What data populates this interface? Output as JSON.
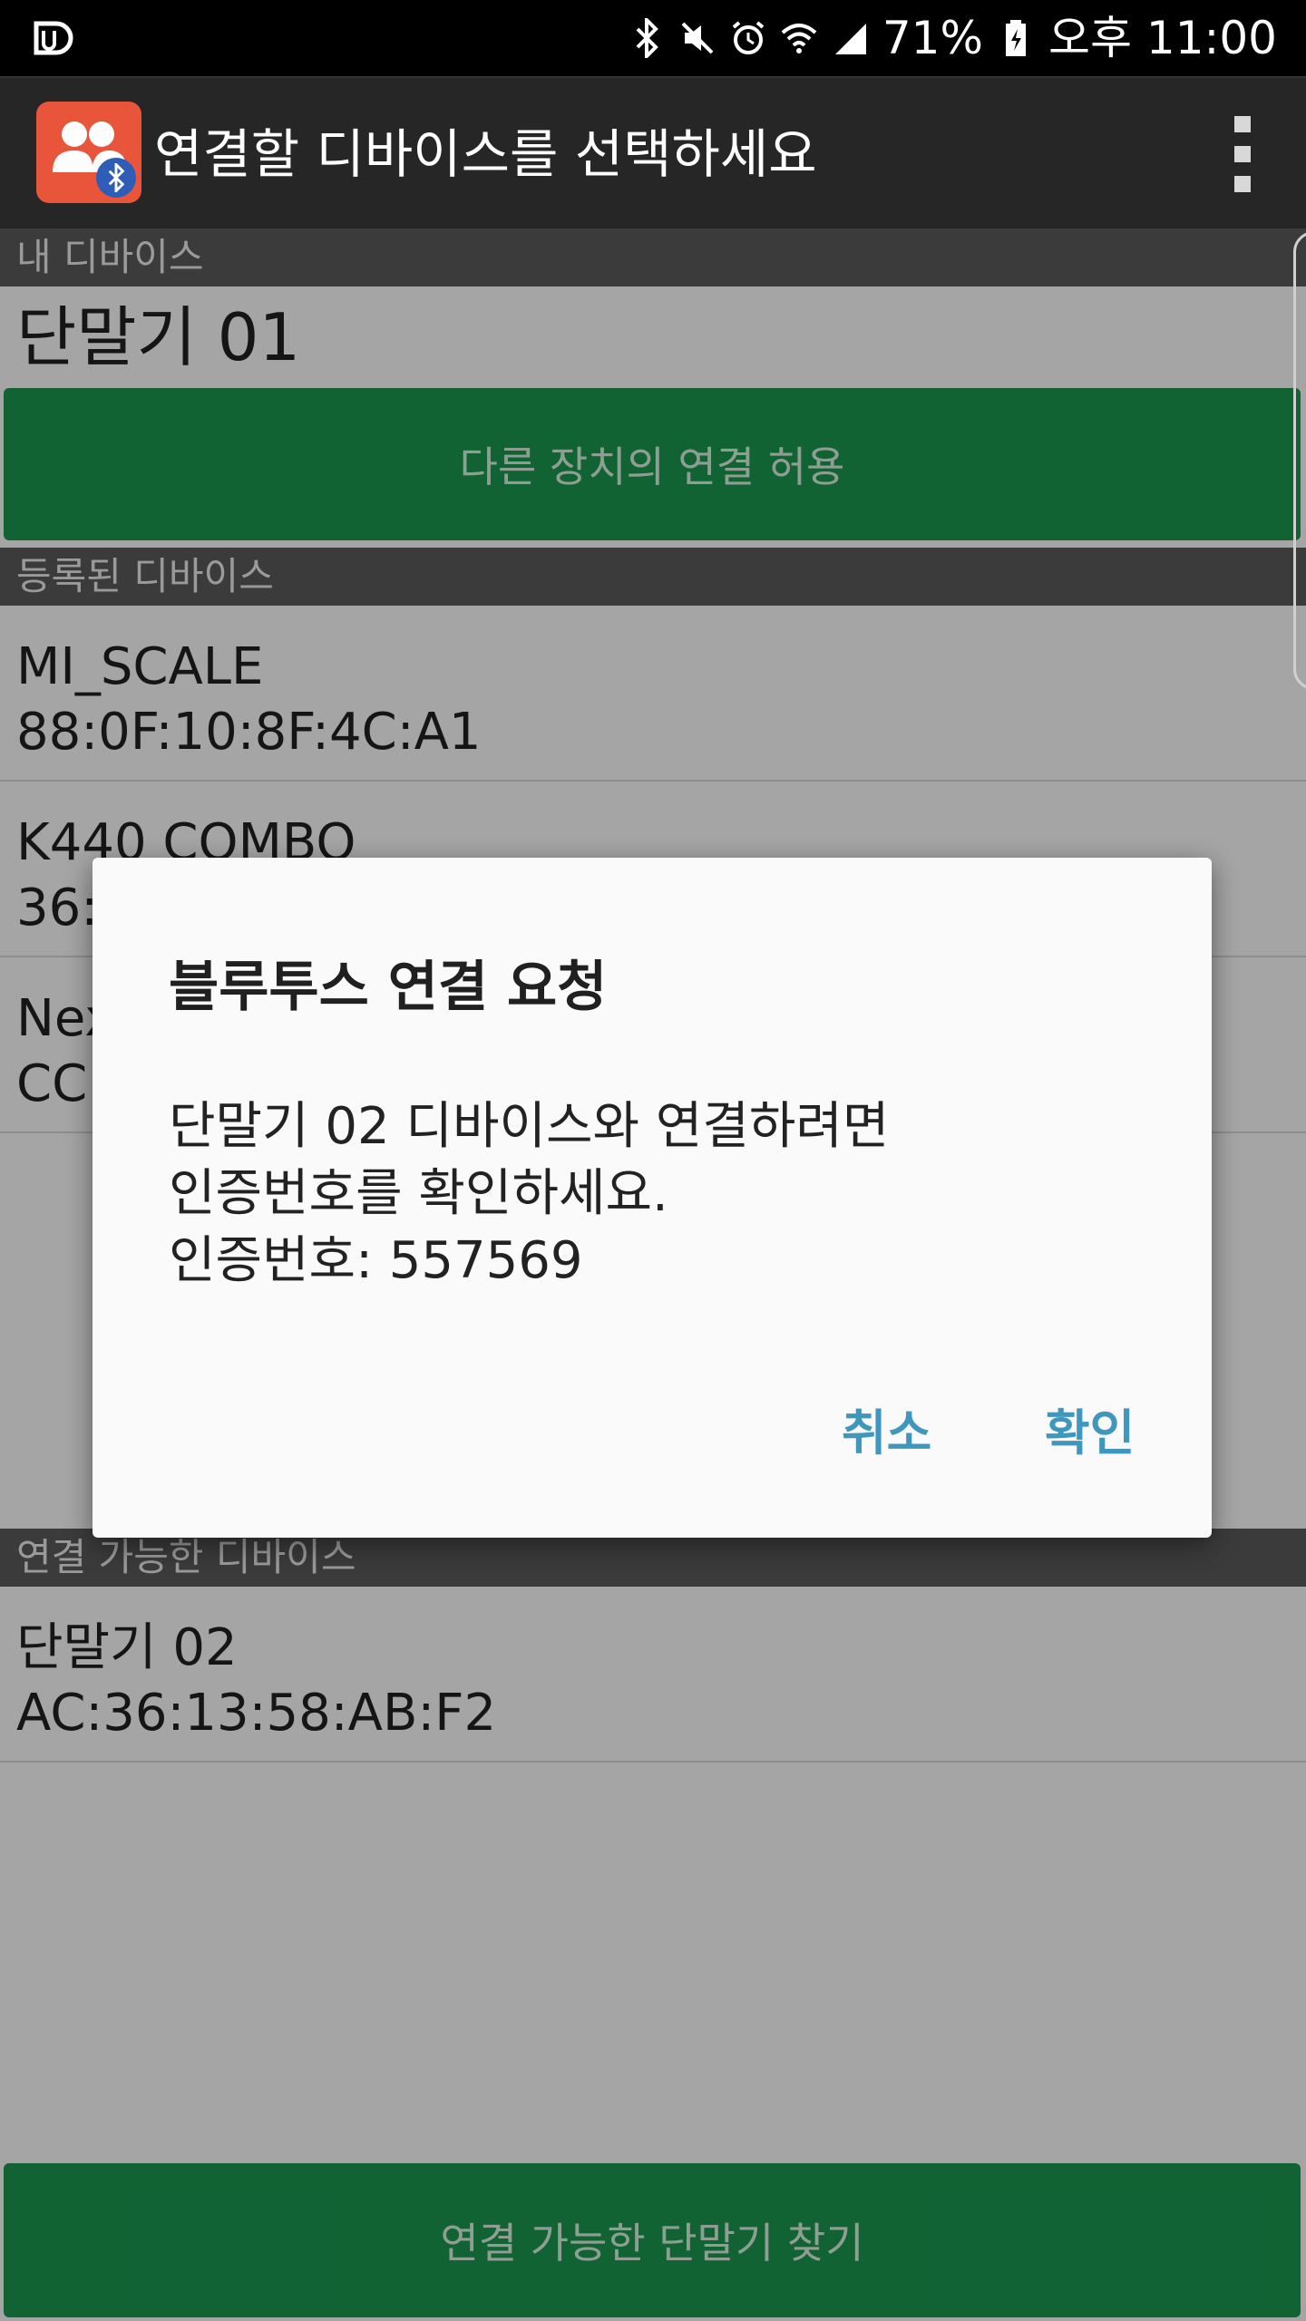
{
  "status_bar": {
    "battery": "71%",
    "time": "오후 11:00",
    "icons": [
      "app-notification-icon",
      "bluetooth-icon",
      "mute-icon",
      "alarm-icon",
      "wifi-icon",
      "signal-icon",
      "battery-charging-icon"
    ]
  },
  "app_bar": {
    "title": "연결할 디바이스를 선택하세요",
    "icon": "bluetooth-users-app-icon",
    "menu_icon": "overflow-menu-icon"
  },
  "my_device": {
    "header": "내 디바이스",
    "name": "단말기 01",
    "allow_button": "다른 장치의 연결 허용"
  },
  "registered_devices": {
    "header": "등록된 디바이스",
    "items": [
      {
        "name": "MI_SCALE",
        "address": "88:0F:10:8F:4C:A1"
      },
      {
        "name": "K440 COMBO",
        "address": "36:"
      },
      {
        "name": "Nex",
        "address": "CC"
      }
    ]
  },
  "available_devices": {
    "header": "연결 가능한 디바이스",
    "items": [
      {
        "name": "단말기 02",
        "address": "AC:36:13:58:AB:F2"
      }
    ]
  },
  "find_button": "연결 가능한 단말기 찾기",
  "dialog": {
    "title": "블루투스 연결 요청",
    "message_line1": "단말기 02 디바이스와 연결하려면",
    "message_line2": "인증번호를 확인하세요.",
    "message_line3": "인증번호: 557569",
    "cancel": "취소",
    "confirm": "확인"
  },
  "colors": {
    "primary_green": "#1a9650",
    "dialog_button": "#3f97bd",
    "app_icon": "#e8553a"
  }
}
